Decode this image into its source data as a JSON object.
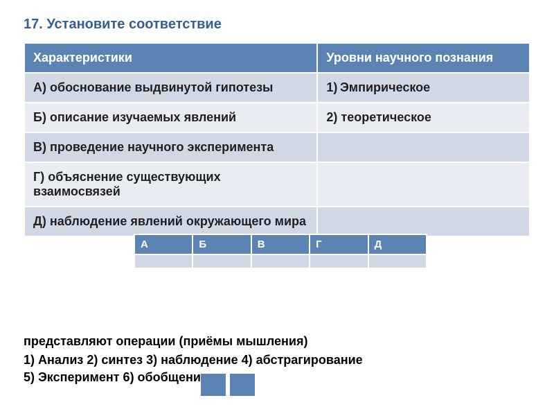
{
  "title": "17. Установите соответствие",
  "table": {
    "header_left": "Характеристики",
    "header_right": "Уровни научного познания",
    "rows": [
      {
        "left": "А) обоснование выдвинутой гипотезы",
        "right": "1) Эмпирическое"
      },
      {
        "left": "Б) описание изучаемых явлений",
        "right": "2) теоретическое"
      },
      {
        "left": "В) проведение научного эксперимента",
        "right": ""
      },
      {
        "left": "Г) объяснение существующих взаимосвязей",
        "right": ""
      },
      {
        "left": "Д) наблюдение явлений окружающего мира",
        "right": ""
      }
    ]
  },
  "answer_grid": {
    "headers": [
      "А",
      "Б",
      "В",
      "Г",
      "Д"
    ],
    "cells": [
      "",
      "",
      "",
      "",
      ""
    ]
  },
  "partial_text": "представляют операции (приёмы мышления)",
  "options_line1": "1)  Анализ 2) синтез 3) наблюдение 4) абстрагирование",
  "options_line2": "5) Эксперимент 6) обобщение",
  "colors": {
    "accent": "#5b83b4",
    "title": "#355f92",
    "row_odd": "#d1d8e5",
    "row_even": "#e9edf3"
  }
}
